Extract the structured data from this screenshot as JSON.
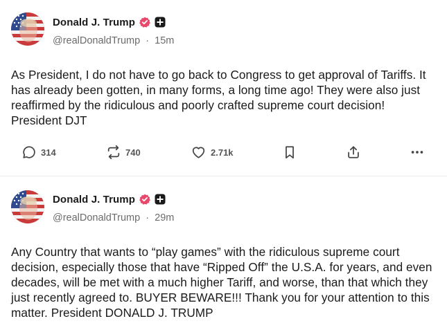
{
  "posts": [
    {
      "author": {
        "name": "Donald J. Trump",
        "handle": "@realDonaldTrump",
        "time": "15m",
        "avatar_icon": "flag-face-avatar",
        "verified_color": "#e8496a"
      },
      "text": "As President, I do not have to go back to Congress to get approval of Tariffs. It has already been gotten, in many forms, a long time ago! They were also just reaffirmed by the ridiculous and poorly crafted supreme court decision! President DJT",
      "stats": {
        "replies": "314",
        "reposts": "740",
        "likes": "2.71k"
      }
    },
    {
      "author": {
        "name": "Donald J. Trump",
        "handle": "@realDonaldTrump",
        "time": "29m",
        "avatar_icon": "flag-face-avatar",
        "verified_color": "#e8496a"
      },
      "text": "Any Country that wants to “play games” with the ridiculous supreme court decision, especially those that have “Ripped Off” the U.S.A. for years, and even decades, will be met with a much higher Tariff, and worse, than that which they just recently agreed to. BUYER BEWARE!!! Thank you for your attention to this matter. President DONALD J. TRUMP"
    }
  ],
  "separator": "·"
}
